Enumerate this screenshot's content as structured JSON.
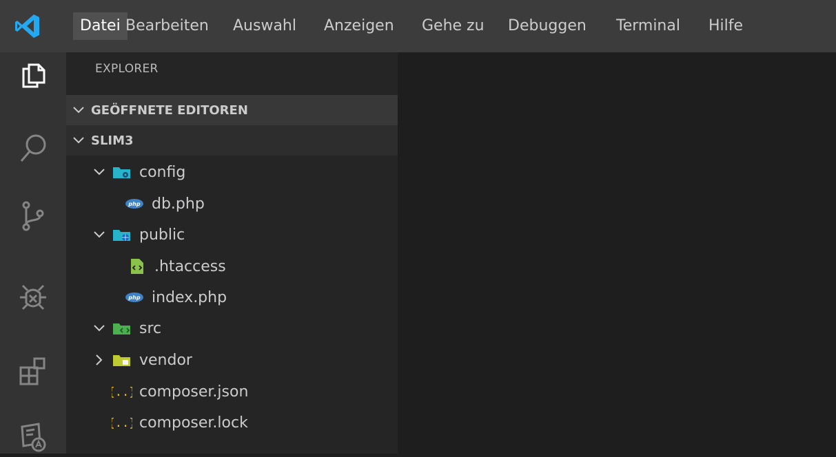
{
  "menubar": {
    "items": [
      "Datei",
      "Bearbeiten",
      "Auswahl",
      "Anzeigen",
      "Gehe zu",
      "Debuggen",
      "Terminal",
      "Hilfe"
    ],
    "active_index": 0
  },
  "activitybar": {
    "icons": [
      "explorer-icon",
      "search-icon",
      "source-control-icon",
      "debug-icon",
      "extensions-icon",
      "language-icon"
    ]
  },
  "sidebar": {
    "title": "EXPLORER",
    "open_editors_label": "GEÖFFNETE EDITOREN",
    "project_label": "SLIM3",
    "tree": [
      {
        "label": "config",
        "icon": "config-folder-icon",
        "depth": 1,
        "expanded": true
      },
      {
        "label": "db.php",
        "icon": "php-file-icon",
        "depth": 2
      },
      {
        "label": "public",
        "icon": "public-folder-icon",
        "depth": 1,
        "expanded": true
      },
      {
        "label": ".htaccess",
        "icon": "htaccess-file-icon",
        "depth": 2
      },
      {
        "label": "index.php",
        "icon": "php-file-icon",
        "depth": 2
      },
      {
        "label": "src",
        "icon": "src-folder-icon",
        "depth": 1,
        "expanded": true
      },
      {
        "label": "vendor",
        "icon": "vendor-folder-icon",
        "depth": 1,
        "expanded": false
      },
      {
        "label": "composer.json",
        "icon": "json-file-icon",
        "depth": 1
      },
      {
        "label": "composer.lock",
        "icon": "json-file-icon",
        "depth": 1
      }
    ]
  },
  "colors": {
    "menubar_bg": "#3c3c3c",
    "activitybar_bg": "#333333",
    "sidebar_bg": "#252526",
    "editor_bg": "#1e1e1e",
    "vscode_blue": "#23a9f2",
    "php_blue": "#3f82c8",
    "json_yellow": "#f0c419",
    "folder_teal": "#27b3c9",
    "folder_green": "#8bc34a",
    "folder_yellow": "#c0ca33"
  }
}
